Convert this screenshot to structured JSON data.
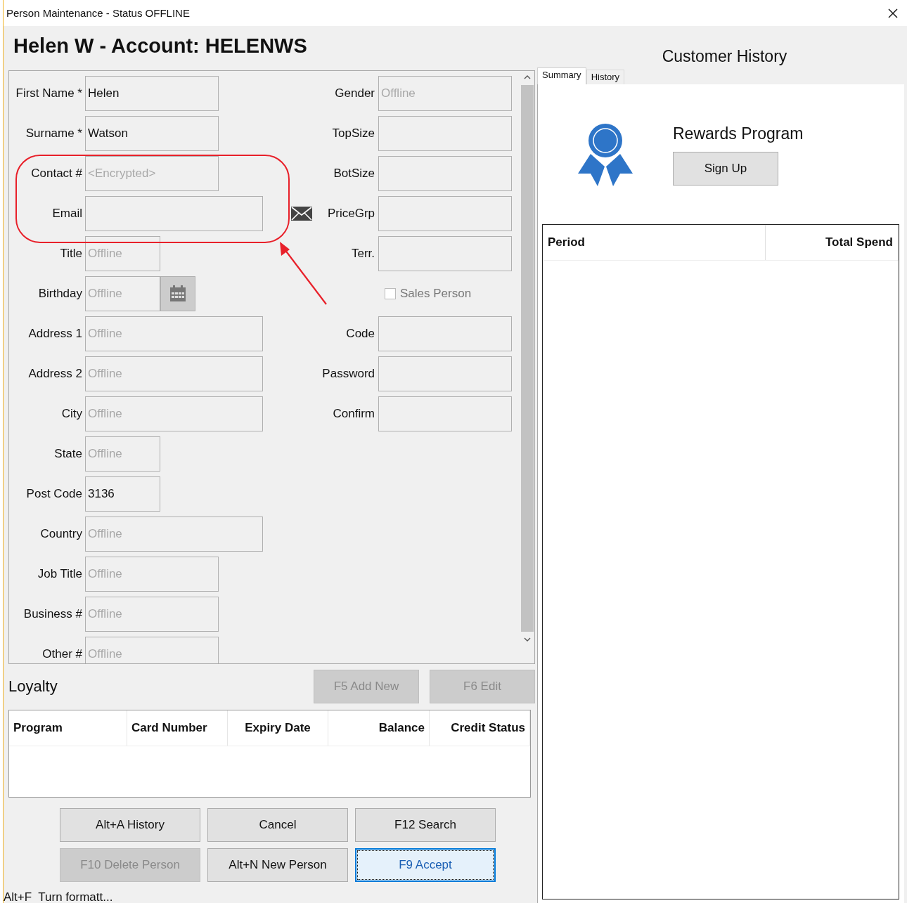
{
  "window": {
    "title": "Person Maintenance - Status OFFLINE"
  },
  "heading": "Helen W - Account: HELENWS",
  "form": {
    "left_fields": [
      {
        "label": "First Name *",
        "kind": "text",
        "value": "Helen"
      },
      {
        "label": "Surname *",
        "kind": "text",
        "value": "Watson"
      },
      {
        "label": "Contact #",
        "kind": "text",
        "placeholder": "<Encrypted>"
      },
      {
        "label": "Email",
        "kind": "email"
      },
      {
        "label": "Title",
        "kind": "text",
        "placeholder": "Offline"
      },
      {
        "label": "Birthday",
        "kind": "date",
        "placeholder": "Offline"
      },
      {
        "label": "Address 1",
        "kind": "text",
        "placeholder": "Offline"
      },
      {
        "label": "Address 2",
        "kind": "text",
        "placeholder": "Offline"
      },
      {
        "label": "City",
        "kind": "text",
        "placeholder": "Offline"
      },
      {
        "label": "State",
        "kind": "text",
        "placeholder": "Offline"
      },
      {
        "label": "Post Code",
        "kind": "text",
        "value": "3136"
      },
      {
        "label": "Country",
        "kind": "text",
        "placeholder": "Offline"
      },
      {
        "label": "Job Title",
        "kind": "text",
        "placeholder": "Offline"
      },
      {
        "label": "Business #",
        "kind": "text",
        "placeholder": "Offline"
      },
      {
        "label": "Other #",
        "kind": "text",
        "placeholder": "Offline"
      }
    ],
    "right_fields": [
      {
        "label": "Gender",
        "kind": "text",
        "placeholder": "Offline"
      },
      {
        "label": "TopSize",
        "kind": "text"
      },
      {
        "label": "BotSize",
        "kind": "text"
      },
      {
        "label": "PriceGrp",
        "kind": "text"
      },
      {
        "label": "Terr.",
        "kind": "text"
      },
      {
        "label": "Sales Person",
        "kind": "checkbox",
        "checked": false
      },
      {
        "label": "Code",
        "kind": "text"
      },
      {
        "label": "Password",
        "kind": "text"
      },
      {
        "label": "Confirm",
        "kind": "text"
      }
    ]
  },
  "loyalty": {
    "title": "Loyalty",
    "buttons": [
      {
        "label": "F5 Add New",
        "disabled": true
      },
      {
        "label": "F6 Edit",
        "disabled": true
      }
    ],
    "table": {
      "columns": [
        "Program",
        "Card Number",
        "Expiry Date",
        "Balance",
        "Credit Status"
      ]
    }
  },
  "actions": [
    {
      "label": "Alt+A History",
      "disabled": false,
      "focused": false
    },
    {
      "label": "Cancel",
      "disabled": false,
      "focused": false
    },
    {
      "label": "F12 Search",
      "disabled": false,
      "focused": false
    },
    {
      "label": "F10 Delete Person",
      "disabled": true,
      "focused": false
    },
    {
      "label": "Alt+N New Person",
      "disabled": false,
      "focused": false
    },
    {
      "label": "F9 Accept",
      "disabled": false,
      "focused": true
    }
  ],
  "status_bar": "Alt+F  Turn formatt...",
  "customer_history": {
    "title": "Customer History",
    "tabs": [
      {
        "label": "Summary",
        "selected": true
      },
      {
        "label": "History",
        "selected": false
      }
    ],
    "rewards": {
      "title": "Rewards Program",
      "button": "Sign Up"
    },
    "table": {
      "columns": [
        "Period",
        "Total Spend"
      ]
    }
  }
}
